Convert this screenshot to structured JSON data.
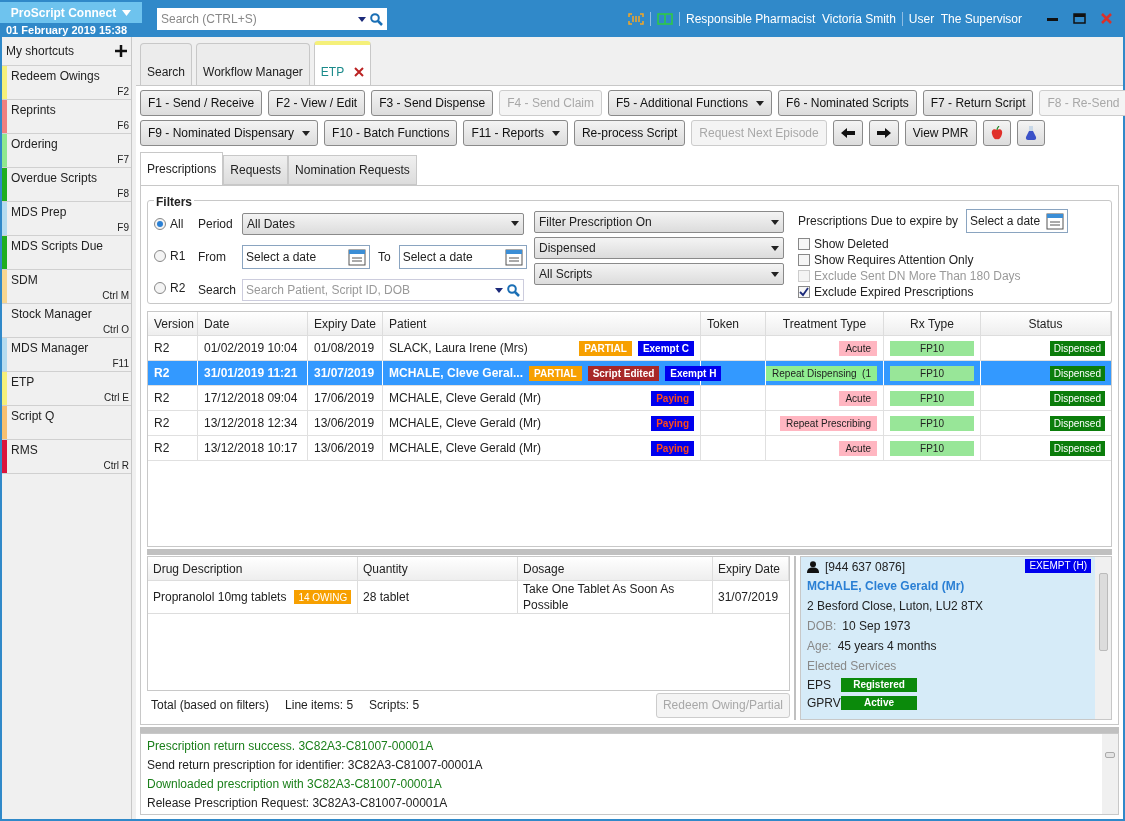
{
  "header": {
    "app_button": "ProScript Connect",
    "datetime": "01 February 2019 15:38",
    "search": {
      "placeholder": "Search (CTRL+S)"
    },
    "pharmacist": "Responsible Pharmacist  Victoria Smith",
    "user": "User  The Supervisor"
  },
  "sidebar": {
    "title": "My shortcuts",
    "items": [
      {
        "label": "Redeem Owings",
        "shortcut": "F2",
        "color": "#f5f07a"
      },
      {
        "label": "Reprints",
        "shortcut": "F6",
        "color": "#f08080"
      },
      {
        "label": "Ordering",
        "shortcut": "F7",
        "color": "#8fe88f"
      },
      {
        "label": "Overdue Scripts",
        "shortcut": "F8",
        "color": "#1fae1f"
      },
      {
        "label": "MDS Prep",
        "shortcut": "F9",
        "color": "#b5dcf0"
      },
      {
        "label": "MDS Scripts Due",
        "color": "#1fae1f"
      },
      {
        "label": "SDM",
        "shortcut": "Ctrl M",
        "color": "#f7d690"
      },
      {
        "label": "Stock Manager",
        "shortcut": "Ctrl O"
      },
      {
        "label": "MDS Manager",
        "shortcut": "F11",
        "color": "#b5dcf0"
      },
      {
        "label": "ETP",
        "shortcut": "Ctrl E",
        "color": "#f5f07a"
      },
      {
        "label": "Script Q",
        "color": "#f7c070"
      },
      {
        "label": "RMS",
        "shortcut": "Ctrl R",
        "color": "#dc143c"
      }
    ]
  },
  "tabs": [
    {
      "label": "Search",
      "selected": false,
      "closable": false
    },
    {
      "label": "Workflow Manager",
      "selected": false,
      "closable": false
    },
    {
      "label": "ETP",
      "selected": true,
      "closable": true
    }
  ],
  "toolbar": [
    [
      {
        "kind": "text",
        "label": "F1 - Send / Receive",
        "disabled": false,
        "dropdown": false
      },
      {
        "kind": "text",
        "label": "F2 - View / Edit",
        "disabled": false,
        "dropdown": false
      },
      {
        "kind": "text",
        "label": "F3 - Send Dispense",
        "disabled": false,
        "dropdown": false
      },
      {
        "kind": "text",
        "label": "F4 - Send Claim",
        "disabled": true,
        "dropdown": false
      },
      {
        "kind": "text",
        "label": "F5 - Additional Functions",
        "disabled": false,
        "dropdown": true
      },
      {
        "kind": "text",
        "label": "F6 - Nominated Scripts",
        "disabled": false,
        "dropdown": false
      },
      {
        "kind": "text",
        "label": "F7 - Return Script",
        "disabled": false,
        "dropdown": false
      },
      {
        "kind": "text",
        "label": "F8 - Re-Send",
        "disabled": true,
        "dropdown": false
      }
    ],
    [
      {
        "kind": "text",
        "label": "F9 - Nominated Dispensary",
        "disabled": false,
        "dropdown": true
      },
      {
        "kind": "text",
        "label": "F10 - Batch Functions",
        "disabled": false,
        "dropdown": false
      },
      {
        "kind": "text",
        "label": "F11 - Reports",
        "disabled": false,
        "dropdown": true
      },
      {
        "kind": "text",
        "label": "Re-process Script",
        "disabled": false,
        "dropdown": false
      },
      {
        "kind": "text",
        "label": "Request Next Episode",
        "disabled": true,
        "dropdown": false
      },
      {
        "kind": "back",
        "disabled": false
      },
      {
        "kind": "forward",
        "disabled": false
      },
      {
        "kind": "text",
        "label": "View PMR",
        "disabled": false,
        "dropdown": false
      },
      {
        "kind": "apple",
        "disabled": false
      },
      {
        "kind": "flask",
        "disabled": false
      }
    ]
  ],
  "subtabs": [
    {
      "label": "Prescriptions",
      "selected": true
    },
    {
      "label": "Requests",
      "selected": false
    },
    {
      "label": "Nomination Requests",
      "selected": false
    }
  ],
  "filters": {
    "title": "Filters",
    "versions": [
      {
        "label": "All",
        "selected": true
      },
      {
        "label": "R1",
        "selected": false
      },
      {
        "label": "R2",
        "selected": false
      }
    ],
    "period_label": "Period",
    "period": "All Dates",
    "from_label": "From",
    "from": {
      "placeholder": "Select a date"
    },
    "to_label": "To",
    "to": {
      "placeholder": "Select a date"
    },
    "search_label": "Search",
    "search": {
      "placeholder": "Search Patient, Script ID, DOB"
    },
    "dropdowns": [
      "Filter Prescription On",
      "Dispensed",
      "All Scripts"
    ],
    "expire_label": "Prescriptions Due to expire by",
    "expire": {
      "placeholder": "Select a date"
    },
    "checkboxes": [
      {
        "label": "Show Deleted",
        "checked": false,
        "disabled": false
      },
      {
        "label": "Show Requires Attention Only",
        "checked": false,
        "disabled": false
      },
      {
        "label": "Exclude Sent DN More Than 180 Days",
        "checked": false,
        "disabled": true
      },
      {
        "label": "Exclude Expired Prescriptions",
        "checked": true,
        "disabled": false
      }
    ]
  },
  "prescriptions": {
    "columns": [
      "Version",
      "Date",
      "Expiry Date",
      "Patient",
      "Token",
      "Treatment Type",
      "Rx Type",
      "Status"
    ],
    "rows": [
      {
        "selected": false,
        "version": "R2",
        "date": "01/02/2019 10:04",
        "expiry": "01/08/2019",
        "patient": "SLACK, Laura Irene (Mrs)",
        "tags": [
          {
            "kind": "partial",
            "label": "PARTIAL"
          },
          {
            "kind": "exempt",
            "label": "Exempt C"
          }
        ],
        "treatment": {
          "label": "Acute",
          "color": "#ffb6c1"
        },
        "rx_type": "FP10",
        "status": "Dispensed"
      },
      {
        "selected": true,
        "version": "R2",
        "date": "31/01/2019 11:21",
        "expiry": "31/07/2019",
        "patient": "MCHALE, Cleve Geral...",
        "tags": [
          {
            "kind": "partial",
            "label": "PARTIAL"
          },
          {
            "kind": "edited",
            "label": "Script Edited"
          },
          {
            "kind": "exempt",
            "label": "Exempt H"
          }
        ],
        "treatment": {
          "label": "Repeat Dispensing  (1",
          "color": "#90ee90"
        },
        "rx_type": "FP10",
        "status": "Dispensed"
      },
      {
        "selected": false,
        "version": "R2",
        "date": "17/12/2018 09:04",
        "expiry": "17/06/2019",
        "patient": "MCHALE, Cleve Gerald (Mr)",
        "tags": [
          {
            "kind": "paying",
            "label": "Paying"
          }
        ],
        "treatment": {
          "label": "Acute",
          "color": "#ffb6c1"
        },
        "rx_type": "FP10",
        "status": "Dispensed"
      },
      {
        "selected": false,
        "version": "R2",
        "date": "13/12/2018 12:34",
        "expiry": "13/06/2019",
        "patient": "MCHALE, Cleve Gerald (Mr)",
        "tags": [
          {
            "kind": "paying",
            "label": "Paying"
          }
        ],
        "treatment": {
          "label": "Repeat Prescribing",
          "color": "#ffb6c1"
        },
        "rx_type": "FP10",
        "status": "Dispensed"
      },
      {
        "selected": false,
        "version": "R2",
        "date": "13/12/2018 10:17",
        "expiry": "13/06/2019",
        "patient": "MCHALE, Cleve Gerald (Mr)",
        "tags": [
          {
            "kind": "paying",
            "label": "Paying"
          }
        ],
        "treatment": {
          "label": "Acute",
          "color": "#ffb6c1"
        },
        "rx_type": "FP10",
        "status": "Dispensed"
      }
    ]
  },
  "items": {
    "columns": [
      "Drug Description",
      "Quantity",
      "Dosage",
      "Expiry Date"
    ],
    "rows": [
      {
        "drug": "Propranolol 10mg tablets",
        "badge": "14 OWING",
        "quantity": "28 tablet",
        "dosage": "Take One Tablet As Soon As Possible",
        "expiry": "31/07/2019"
      }
    ],
    "totals": [
      "Total (based on filters)",
      "Line items: 5",
      "Scripts: 5"
    ],
    "redeem_button": {
      "label": "Redeem Owing/Partial",
      "disabled": true
    }
  },
  "patient": {
    "nhs_number": "[944 637 0876]",
    "exemption": "EXEMPT (H)",
    "name": "MCHALE, Cleve Gerald (Mr)",
    "address": "2 Besford Close, Luton, LU2 8TX",
    "dob_label": "DOB:",
    "dob": "10 Sep 1973",
    "age_label": "Age:",
    "age": "45 years 4 months",
    "services_title": "Elected Services",
    "services": [
      {
        "name": "EPS",
        "status": "Registered"
      },
      {
        "name": "GPRV",
        "status": "Active"
      }
    ]
  },
  "log": [
    {
      "kind": "success",
      "text": "Prescription return success. 3C82A3-C81007-00001A"
    },
    {
      "kind": "info",
      "text": "Send return prescription for identifier: 3C82A3-C81007-00001A"
    },
    {
      "kind": "success",
      "text": "Downloaded prescription with 3C82A3-C81007-00001A"
    },
    {
      "kind": "info",
      "text": "Release Prescription Request: 3C82A3-C81007-00001A"
    }
  ]
}
